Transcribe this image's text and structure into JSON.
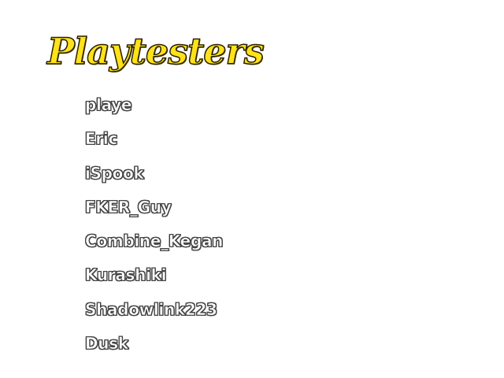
{
  "title": "Playtesters",
  "names": [
    "playe",
    "Eric",
    "iSpook",
    "FKER_Guy",
    "Combine_Kegan",
    "Kurashiki",
    "Shadowlink223",
    "Dusk"
  ],
  "colors": {
    "title_fill": "#ffe21a",
    "title_outline": "#2a2100",
    "name_fill": "#ffffff",
    "name_outline": "#4a4a4a",
    "background": "#ffffff"
  }
}
